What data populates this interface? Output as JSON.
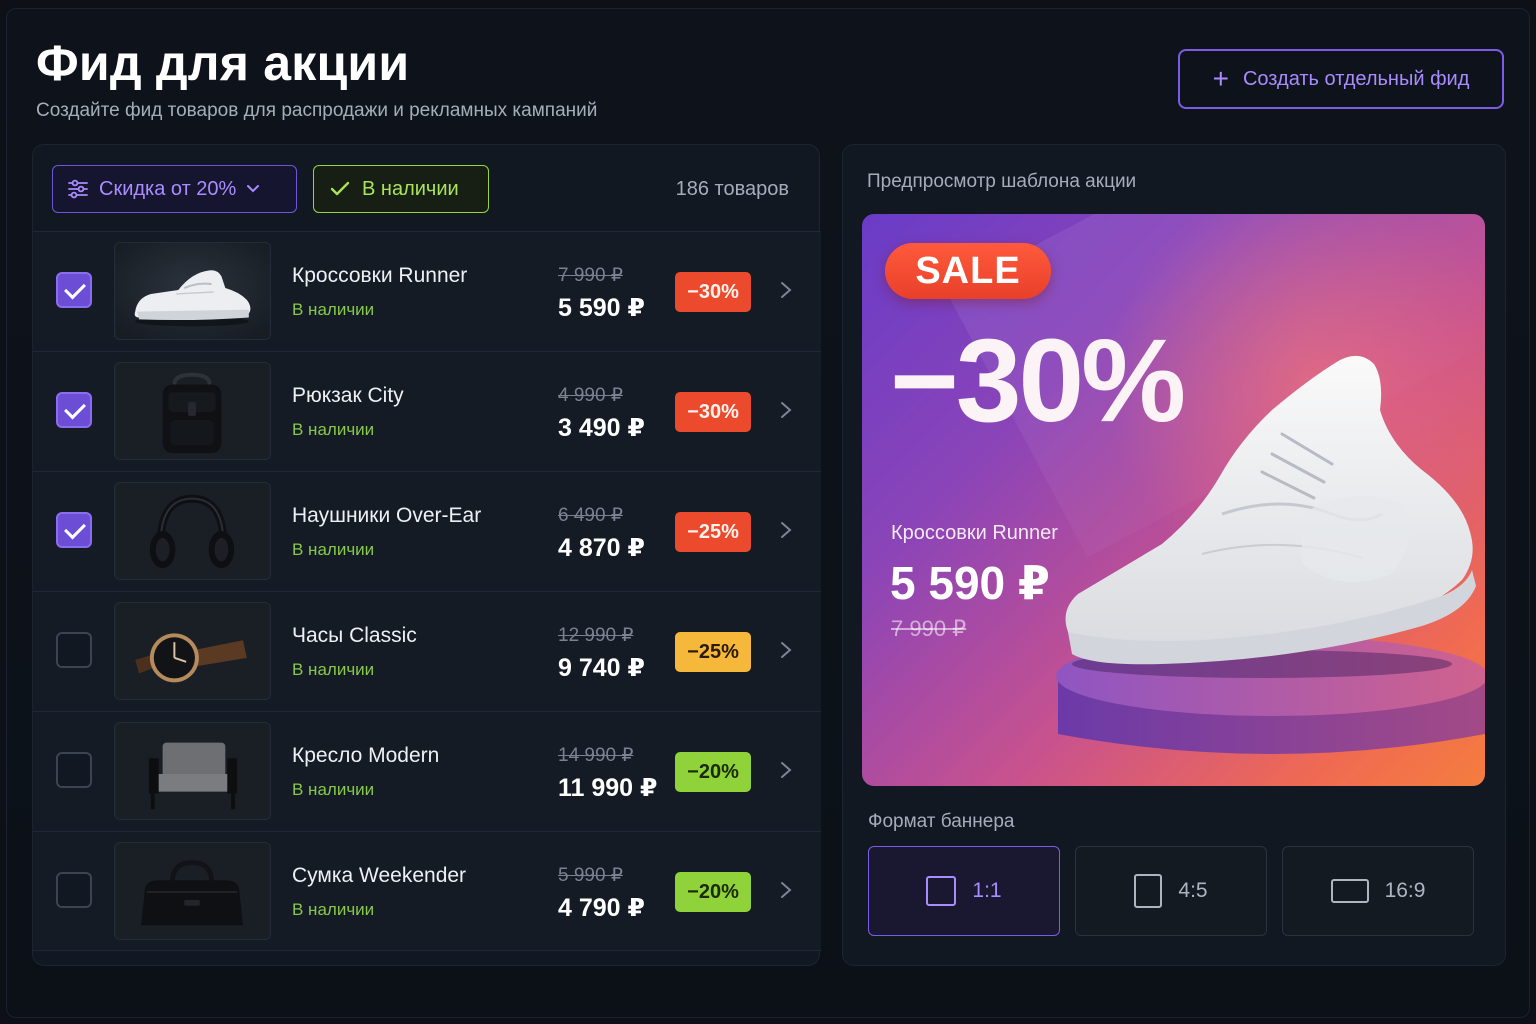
{
  "header": {
    "title": "Фид для акции",
    "subtitle": "Создайте фид товаров для распродажи и рекламных кампаний",
    "create_button_label": "Создать отдельный фид"
  },
  "filters": {
    "discount_label": "Скидка от 20%",
    "stock_label": "В наличии",
    "count_label": "186 товаров"
  },
  "products": [
    {
      "name": "Кроссовки Runner",
      "stock": "В наличии",
      "old_price": "7 990 ₽",
      "price": "5 590 ₽",
      "discount": "−30%",
      "badge_color": "#ec4a2c",
      "checked": true,
      "icon": "sneaker-icon"
    },
    {
      "name": "Рюкзак City",
      "stock": "В наличии",
      "old_price": "4 990 ₽",
      "price": "3 490 ₽",
      "discount": "−30%",
      "badge_color": "#ec4a2c",
      "checked": true,
      "icon": "backpack-icon"
    },
    {
      "name": "Наушники Over-Ear",
      "stock": "В наличии",
      "old_price": "6 490 ₽",
      "price": "4 870 ₽",
      "discount": "−25%",
      "badge_color": "#ec4a2c",
      "checked": true,
      "icon": "headphones-icon"
    },
    {
      "name": "Часы Classic",
      "stock": "В наличии",
      "old_price": "12 990 ₽",
      "price": "9 740 ₽",
      "discount": "−25%",
      "badge_color": "#f5b83b",
      "checked": false,
      "icon": "watch-icon"
    },
    {
      "name": "Кресло Modern",
      "stock": "В наличии",
      "old_price": "14 990 ₽",
      "price": "11 990 ₽",
      "discount": "−20%",
      "badge_color": "#8fd23a",
      "checked": false,
      "icon": "armchair-icon"
    },
    {
      "name": "Сумка Weekender",
      "stock": "В наличии",
      "old_price": "5 990 ₽",
      "price": "4 790 ₽",
      "discount": "−20%",
      "badge_color": "#8fd23a",
      "checked": false,
      "icon": "duffel-bag-icon"
    }
  ],
  "preview": {
    "label": "Предпросмотр шаблона акции",
    "sale_tag": "SALE",
    "discount": "−30%",
    "product_name": "Кроссовки Runner",
    "price": "5 590 ₽",
    "old_price": "7 990 ₽"
  },
  "format": {
    "label": "Формат баннера",
    "options": [
      {
        "label": "1:1",
        "active": true
      },
      {
        "label": "4:5",
        "active": false
      },
      {
        "label": "16:9",
        "active": false
      }
    ]
  },
  "colors": {
    "accent": "#7c5ce6",
    "stock_green": "#86c94a",
    "background": "#0d1117"
  }
}
